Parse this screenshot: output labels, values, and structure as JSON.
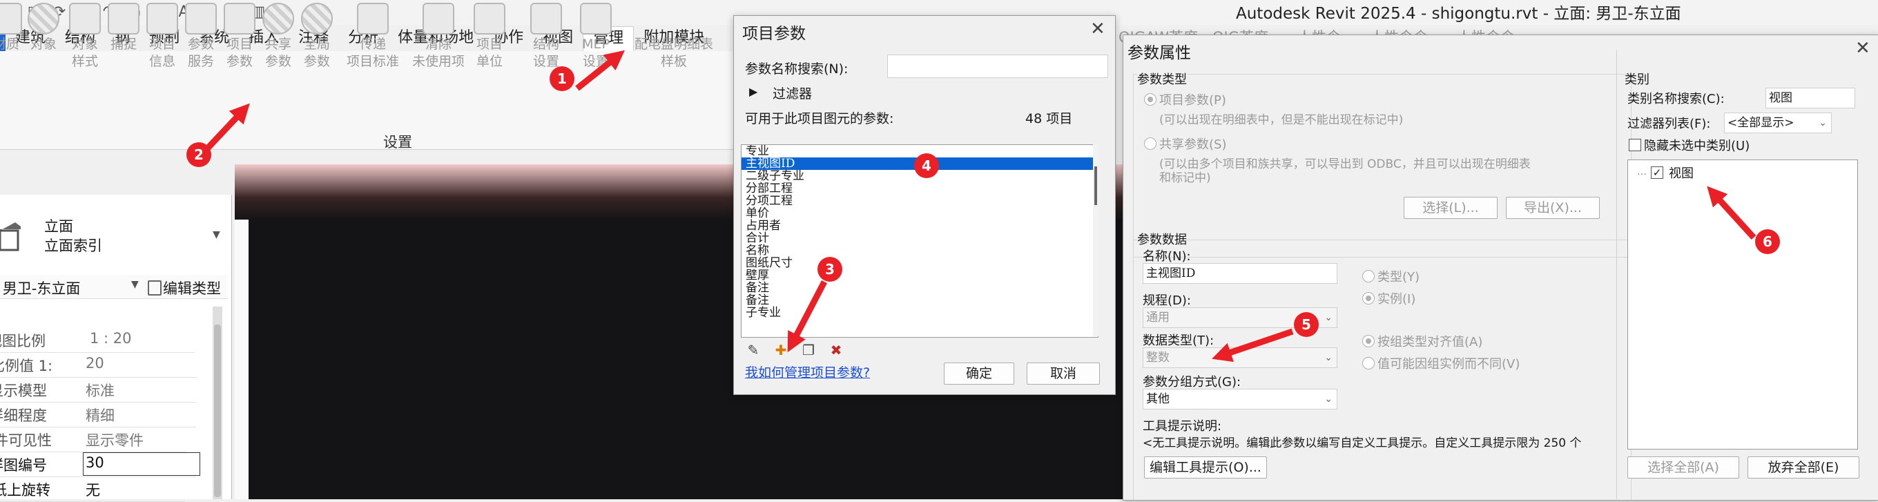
{
  "app": {
    "title": "Autodesk Revit 2025.4 - shigongtu.rvt - 立面: 男卫-东立面",
    "ghost_tabs": "OIGAW茶度　OIG茶度　　人性令　　人性令令　　人性令令"
  },
  "ribbon": {
    "tabs": [
      "建筑",
      "结构",
      "钢",
      "预制",
      "系统",
      "插入",
      "注释",
      "分析",
      "体量和场地",
      "协作",
      "视图",
      "管理",
      "附加模块"
    ],
    "active_tab": "管理",
    "tools": [
      {
        "label": "材质",
        "sub": "",
        "icon": "materials-icon"
      },
      {
        "label": "对象",
        "sub": "样式",
        "icon": "object-styles-icon"
      },
      {
        "label": "捕捉",
        "sub": "",
        "icon": "snaps-icon"
      },
      {
        "label": "项目",
        "sub": "信息",
        "icon": "project-info-icon"
      },
      {
        "label": "参数",
        "sub": "服务",
        "icon": "parameter-service-icon"
      },
      {
        "label": "项目",
        "sub": "参数",
        "icon": "project-parameters-icon"
      },
      {
        "label": "共享",
        "sub": "参数",
        "icon": "shared-parameters-icon"
      },
      {
        "label": "全局",
        "sub": "参数",
        "icon": "global-parameters-icon"
      },
      {
        "label": "传递",
        "sub": "项目标准",
        "icon": "transfer-standards-icon"
      },
      {
        "label": "清除",
        "sub": "未使用项",
        "icon": "purge-icon"
      },
      {
        "label": "项目",
        "sub": "单位",
        "icon": "project-units-icon"
      },
      {
        "label": "结构",
        "sub": "设置",
        "icon": "structural-settings-icon"
      },
      {
        "label": "MEP",
        "sub": "设置",
        "icon": "mep-settings-icon"
      },
      {
        "label": "配电盘明细表",
        "sub": "样板",
        "icon": "panel-schedule-icon"
      }
    ],
    "panel_label": "设置"
  },
  "properties": {
    "type_line1": "立面",
    "type_line2": "立面索引",
    "instance": "立面: 男卫-东立面",
    "edit_type": "编辑类型",
    "rows": [
      {
        "key": "视图比例",
        "value": "1 : 20"
      },
      {
        "key": "比例值 1:",
        "value": "20"
      },
      {
        "key": "显示模型",
        "value": "标准"
      },
      {
        "key": "详细程度",
        "value": "精细"
      },
      {
        "key": "零件可见性",
        "value": "显示零件"
      },
      {
        "key": "详图编号",
        "value": "30"
      },
      {
        "key": "图纸上旋转",
        "value": "无"
      }
    ]
  },
  "project_params_dialog": {
    "title": "项目参数",
    "search_label": "参数名称搜索(N):",
    "search_value": "",
    "filter_label": "过滤器",
    "available_label": "可用于此项目图元的参数:",
    "count": "48 项目",
    "items": [
      "专业",
      "主视图ID",
      "二级子专业",
      "分部工程",
      "分项工程",
      "单价",
      "占用者",
      "合计",
      "名称",
      "图纸尺寸",
      "壁厚",
      "备注",
      "备注",
      "子专业"
    ],
    "selected_index": 1,
    "help_link": "我如何管理项目参数?",
    "ok": "确定",
    "cancel": "取消"
  },
  "param_props_dialog": {
    "title": "参数属性",
    "param_type_group": "参数类型",
    "project_param": "项目参数(P)",
    "project_param_desc": "(可以出现在明细表中，但是不能出现在标记中)",
    "shared_param": "共享参数(S)",
    "shared_param_desc1": "(可以由多个项目和族共享，可以导出到 ODBC，并且可以出现在明细表",
    "shared_param_desc2": "和标记中)",
    "select_btn": "选择(L)...",
    "export_btn": "导出(X)...",
    "param_data_group": "参数数据",
    "name_label": "名称(N):",
    "name_value": "主视图ID",
    "discipline_label": "规程(D):",
    "discipline_value": "通用",
    "datatype_label": "数据类型(T):",
    "datatype_value": "整数",
    "grouping_label": "参数分组方式(G):",
    "grouping_value": "其他",
    "type_radio": "类型(Y)",
    "instance_radio": "实例(I)",
    "align_by_group": "按组类型对齐值(A)",
    "vary_by_group": "值可能因组实例而不同(V)",
    "tooltip_label": "工具提示说明:",
    "tooltip_text": "<无工具提示说明。编辑此参数以编写自定义工具提示。自定义工具提示限为 250 个",
    "edit_tooltip": "编辑工具提示(O)...",
    "category_group": "类别",
    "cat_search_label": "类别名称搜索(C):",
    "cat_search_value": "视图",
    "filter_list_label": "过滤器列表(F):",
    "filter_list_value": "<全部显示>",
    "hide_unchecked": "隐藏未选中类别(U)",
    "tree_item": "视图",
    "select_all": "选择全部(A)",
    "deselect_all": "放弃全部(E)"
  },
  "annotations": {
    "markers": [
      "1",
      "2",
      "3",
      "4",
      "5",
      "6"
    ],
    "arrow_color": "#ea2027"
  }
}
